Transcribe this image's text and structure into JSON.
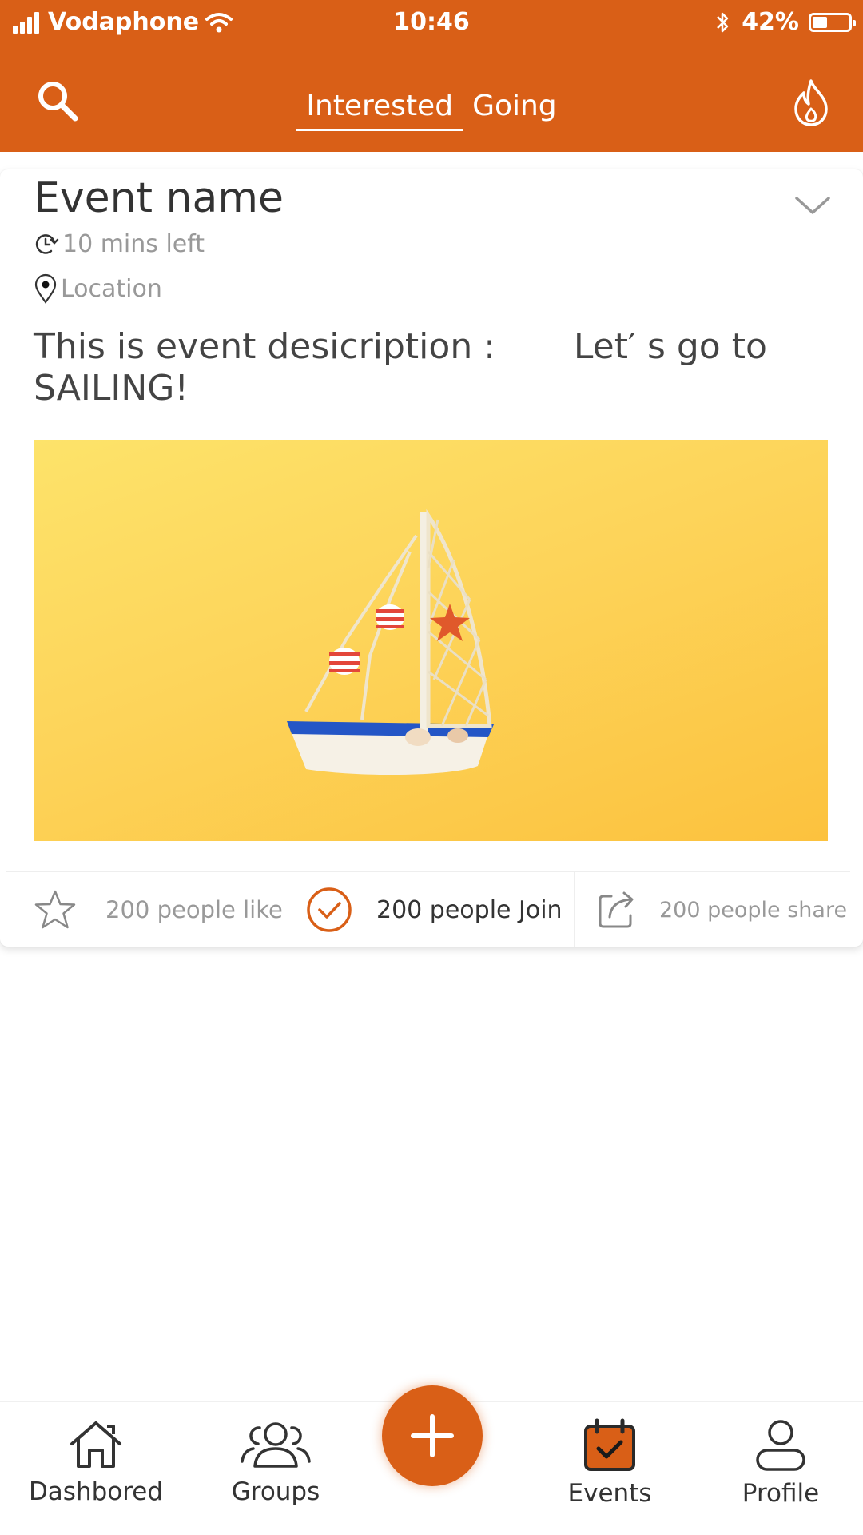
{
  "status_bar": {
    "carrier": "Vodaphone",
    "time": "10:46",
    "battery": "42%",
    "battery_level": 0.42,
    "icons": [
      "signal-icon",
      "wifi-icon",
      "bluetooth-icon",
      "battery-icon"
    ]
  },
  "header": {
    "tabs": [
      {
        "label": "Interested",
        "active": true
      },
      {
        "label": "Going",
        "active": false
      }
    ],
    "icons": {
      "left": "search-icon",
      "right": "fire-icon"
    }
  },
  "event": {
    "name": "Event name",
    "time_left": "10  mins left",
    "location": "Location",
    "description": "This is event desicription :       Let′ s go to SAILING!",
    "image": "sailboat-on-yellow-background",
    "actions": {
      "like": "200 people like",
      "join": "200 people Join",
      "share": "200 people share"
    }
  },
  "bottom_nav": {
    "items": [
      {
        "label": "Dashbored",
        "icon": "home-icon"
      },
      {
        "label": "Groups",
        "icon": "groups-icon"
      },
      {
        "label": "Events",
        "icon": "calendar-check-icon",
        "active": true
      },
      {
        "label": "Profile",
        "icon": "profile-icon"
      }
    ],
    "fab_icon": "plus-icon"
  },
  "colors": {
    "accent": "#d95f17",
    "image_background": "#fdd45a"
  }
}
